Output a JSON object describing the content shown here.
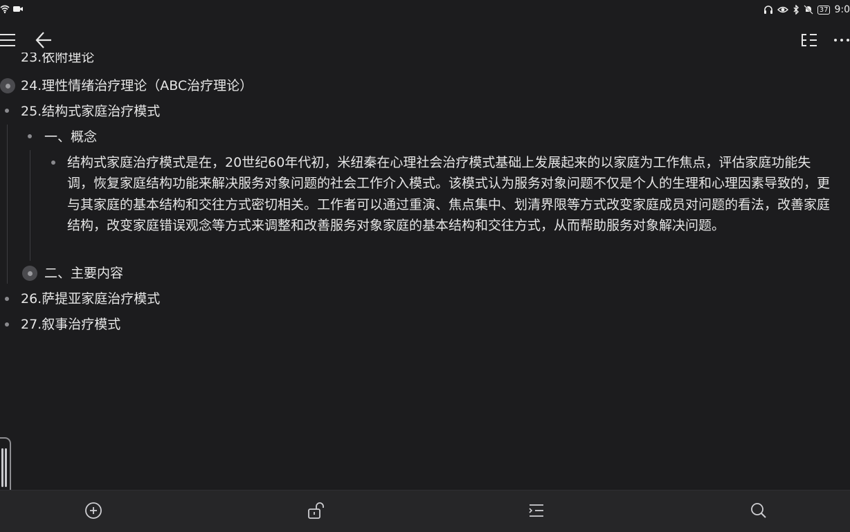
{
  "status_bar": {
    "battery": "37",
    "time": "9:0"
  },
  "outline": {
    "clipped_item": "23.依附理论",
    "items": [
      {
        "label": "24.理性情绪治疗理论（ABC治疗理论）"
      },
      {
        "label": "25.结构式家庭治疗模式",
        "children": [
          {
            "label": "一、概念",
            "paragraph": "结构式家庭治疗模式是在，20世纪60年代初，米纽秦在心理社会治疗模式基础上发展起来的以家庭为工作焦点，评估家庭功能失调，恢复家庭结构功能来解决服务对象问题的社会工作介入模式。该模式认为服务对象问题不仅是个人的生理和心理因素导致的，更与其家庭的基本结构和交往方式密切相关。工作者可以通过重演、焦点集中、划清界限等方式改变家庭成员对问题的看法，改善家庭结构，改变家庭错误观念等方式来调整和改善服务对象家庭的基本结构和交往方式，从而帮助服务对象解决问题。"
          },
          {
            "label": "二、主要内容"
          }
        ]
      },
      {
        "label": "26.萨提亚家庭治疗模式"
      },
      {
        "label": "27.叙事治疗模式"
      }
    ]
  },
  "icons": {
    "top_bar": [
      "menu-icon",
      "back-arrow-icon",
      "outline-collapse-icon",
      "more-icon"
    ],
    "bottom_bar": [
      "add-circle-icon",
      "unlock-icon",
      "list-sort-icon",
      "search-icon"
    ]
  },
  "colors": {
    "background": "#1c1c1e",
    "bottom_bar": "#262628",
    "text": "#e6e6e6",
    "bullet": "#8a8a8e"
  }
}
